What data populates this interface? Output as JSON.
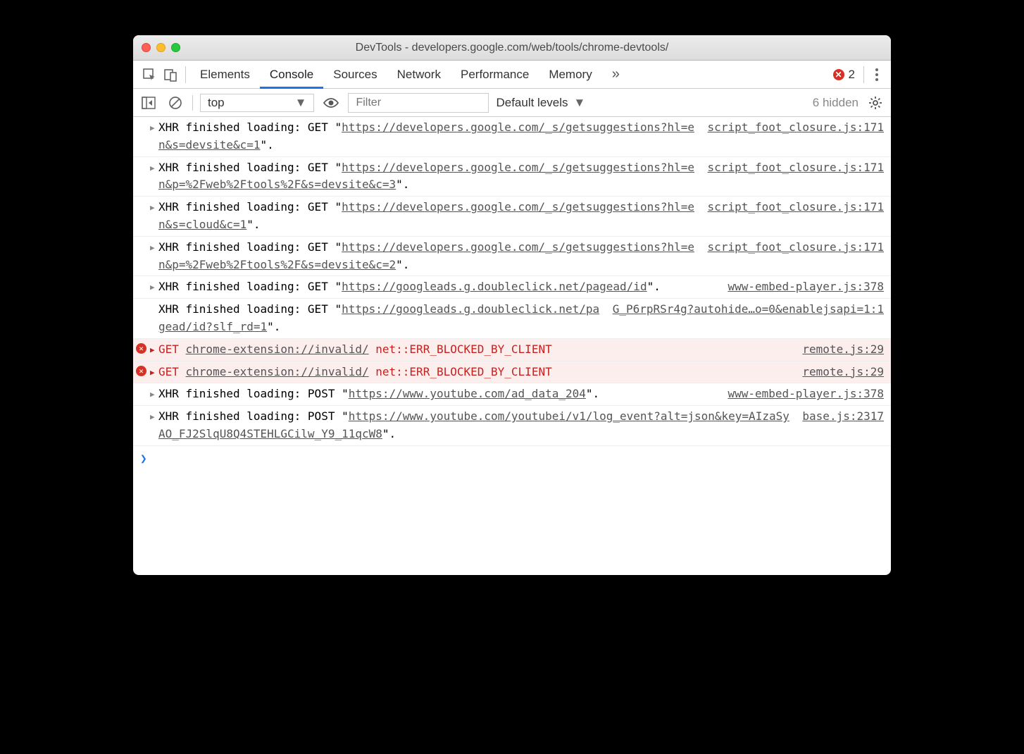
{
  "window": {
    "title": "DevTools - developers.google.com/web/tools/chrome-devtools/"
  },
  "tabs": {
    "elements": "Elements",
    "console": "Console",
    "sources": "Sources",
    "network": "Network",
    "performance": "Performance",
    "memory": "Memory",
    "error_count": "2"
  },
  "toolbar": {
    "context": "top",
    "filter_placeholder": "Filter",
    "levels": "Default levels",
    "hidden": "6 hidden"
  },
  "rows": [
    {
      "kind": "xhr",
      "prefix": "XHR finished loading: GET \"",
      "url": "https://developers.google.com/_s/getsuggestions?hl=en&s=devsite&c=1",
      "suffix": "\".",
      "src": "script_foot_closure.js:171"
    },
    {
      "kind": "xhr",
      "prefix": "XHR finished loading: GET \"",
      "url": "https://developers.google.com/_s/getsuggestions?hl=en&p=%2Fweb%2Ftools%2F&s=devsite&c=3",
      "suffix": "\".",
      "src": "script_foot_closure.js:171"
    },
    {
      "kind": "xhr",
      "prefix": "XHR finished loading: GET \"",
      "url": "https://developers.google.com/_s/getsuggestions?hl=en&s=cloud&c=1",
      "suffix": "\".",
      "src": "script_foot_closure.js:171"
    },
    {
      "kind": "xhr",
      "prefix": "XHR finished loading: GET \"",
      "url": "https://developers.google.com/_s/getsuggestions?hl=en&p=%2Fweb%2Ftools%2F&s=devsite&c=2",
      "suffix": "\".",
      "src": "script_foot_closure.js:171"
    },
    {
      "kind": "xhr",
      "prefix": "XHR finished loading: GET \"",
      "url": "https://googleads.g.doubleclick.net/pagead/id",
      "suffix": "\".",
      "src": "www-embed-player.js:378"
    },
    {
      "kind": "xhr_nodisc",
      "prefix": "XHR finished loading: GET \"",
      "url": "https://googleads.g.doubleclick.net/pagead/id?slf_rd=1",
      "suffix": "\".",
      "src": "G_P6rpRSr4g?autohide…o=0&enablejsapi=1:1"
    },
    {
      "kind": "err",
      "method": "GET",
      "url": "chrome-extension://invalid/",
      "code": "net::ERR_BLOCKED_BY_CLIENT",
      "src": "remote.js:29"
    },
    {
      "kind": "err",
      "method": "GET",
      "url": "chrome-extension://invalid/",
      "code": "net::ERR_BLOCKED_BY_CLIENT",
      "src": "remote.js:29"
    },
    {
      "kind": "xhr",
      "prefix": "XHR finished loading: POST \"",
      "url": "https://www.youtube.com/ad_data_204",
      "suffix": "\".",
      "src": "www-embed-player.js:378"
    },
    {
      "kind": "xhr",
      "prefix": "XHR finished loading: POST \"",
      "url": "https://www.youtube.com/youtubei/v1/log_event?alt=json&key=AIzaSyAO_FJ2SlqU8Q4STEHLGCilw_Y9_11qcW8",
      "suffix": "\".",
      "src": "base.js:2317"
    }
  ]
}
